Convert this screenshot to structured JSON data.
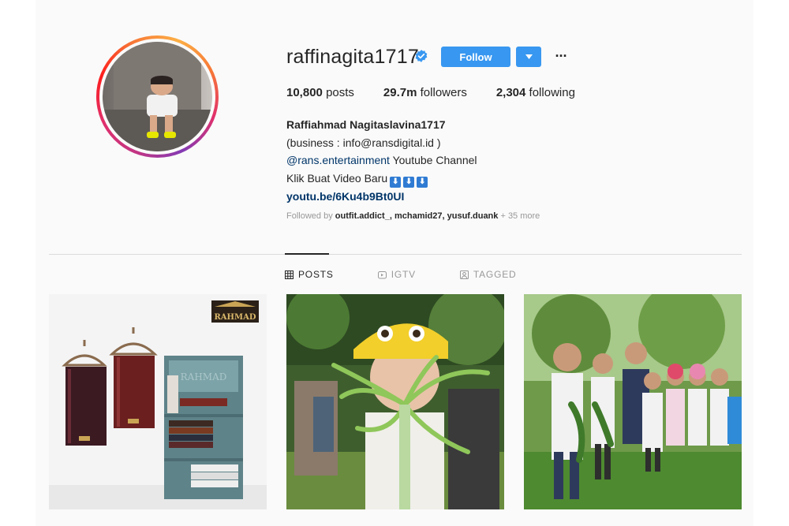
{
  "profile": {
    "username": "raffinagita1717",
    "follow_label": "Follow",
    "dropdown_icon": "caret-down-icon",
    "more_icon": "ellipsis-icon",
    "more_label": "···",
    "accent_color": "#3897f0",
    "verified_color": "#3897f0"
  },
  "stats": {
    "posts_count": "10,800",
    "posts_label": "posts",
    "followers_count": "29.7m",
    "followers_label": "followers",
    "following_count": "2,304",
    "following_label": "following"
  },
  "bio": {
    "full_name": "Raffiahmad Nagitaslavina1717",
    "line1": "(business : info@ransdigital.id )",
    "mention": "@rans.entertainment",
    "line2_rest": " Youtube Channel",
    "line3": "Klik Buat Video Baru",
    "emoji": "⬇",
    "website": "youtu.be/6Ku4b9Bt0UI"
  },
  "followed_by": {
    "prefix": "Followed by ",
    "user1": "outfit.addict_",
    "sep1": ", ",
    "user2": "mchamid27",
    "sep2": ", ",
    "user3": "yusuf.duank",
    "suffix": " + 35 more"
  },
  "tabs": [
    {
      "label": "POSTS",
      "icon": "grid-icon",
      "active": true
    },
    {
      "label": "IGTV",
      "icon": "igtv-icon",
      "active": false
    },
    {
      "label": "TAGGED",
      "icon": "tagged-icon",
      "active": false
    }
  ],
  "posts": [
    {
      "brand_text": "RAHMAD"
    },
    {},
    {}
  ]
}
